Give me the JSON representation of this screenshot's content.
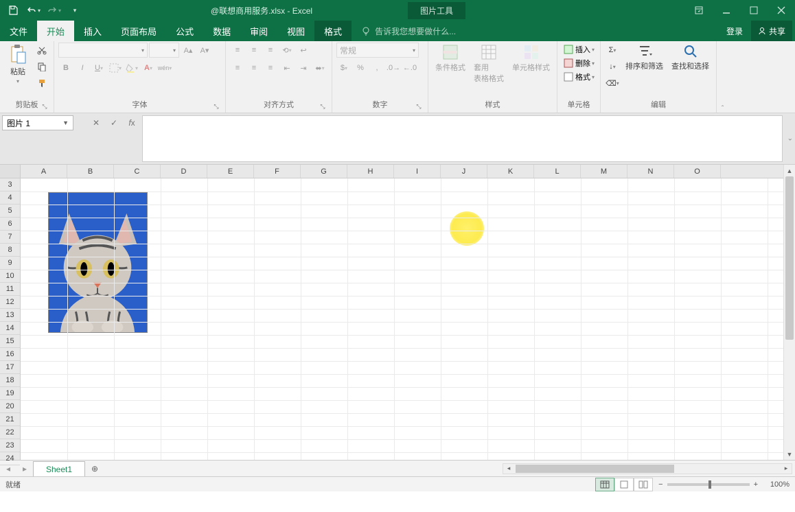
{
  "titlebar": {
    "doc_title": "@联想商用服务.xlsx - Excel",
    "context_tool": "图片工具"
  },
  "tabs": {
    "file": "文件",
    "home": "开始",
    "insert": "插入",
    "layout": "页面布局",
    "formulas": "公式",
    "data": "数据",
    "review": "审阅",
    "view": "视图",
    "format_ctx": "格式",
    "tellme_placeholder": "告诉我您想要做什么...",
    "login": "登录",
    "share": "共享"
  },
  "ribbon": {
    "clipboard": {
      "paste": "粘贴",
      "label": "剪贴板"
    },
    "font": {
      "label": "字体",
      "size": ""
    },
    "align": {
      "label": "对齐方式"
    },
    "number": {
      "label": "数字",
      "format": "常规"
    },
    "styles": {
      "cond": "条件格式",
      "table": "套用\n表格格式",
      "cell": "单元格样式",
      "label": "样式"
    },
    "cells": {
      "insert": "插入",
      "delete": "删除",
      "format": "格式",
      "label": "单元格"
    },
    "editing": {
      "sort": "排序和筛选",
      "find": "查找和选择",
      "label": "编辑"
    }
  },
  "namebox": {
    "value": "图片 1"
  },
  "columns": [
    "A",
    "B",
    "C",
    "D",
    "E",
    "F",
    "G",
    "H",
    "I",
    "J",
    "K",
    "L",
    "M",
    "N",
    "O"
  ],
  "rows": [
    "3",
    "4",
    "5",
    "6",
    "7",
    "8",
    "9",
    "10",
    "11",
    "12",
    "13",
    "14",
    "15",
    "16",
    "17",
    "18",
    "19",
    "20",
    "21",
    "22",
    "23",
    "24"
  ],
  "sheets": {
    "sheet1": "Sheet1"
  },
  "status": {
    "ready": "就绪",
    "zoom": "100%"
  }
}
